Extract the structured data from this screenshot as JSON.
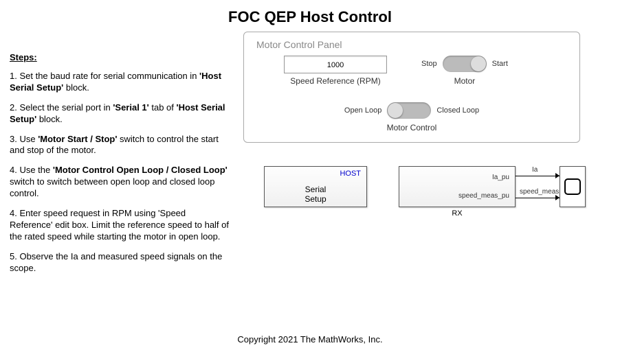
{
  "title": "FOC QEP Host Control",
  "steps_heading": "Steps:",
  "steps": {
    "s1a": "1. Set the baud rate for serial communication in ",
    "s1b": "'Host Serial Setup'",
    "s1c": " block.",
    "s2a": "2. Select the serial port in ",
    "s2b": "'Serial 1'",
    "s2c": " tab of  ",
    "s2d": "'Host Serial Setup'",
    "s2e": " block.",
    "s3a": "3. Use ",
    "s3b": "'Motor Start / Stop'",
    "s3c": " switch to control the start and stop of the motor.",
    "s4a": "4. Use the ",
    "s4b": "'Motor Control Open Loop / Closed Loop'",
    "s4c": " switch to switch between open loop and closed loop control.",
    "s5": "4. Enter speed request in RPM using 'Speed Reference' edit box. Limit the reference speed to half of the rated speed while starting the motor in open loop.",
    "s6": "5. Observe the Ia and measured speed signals on the scope."
  },
  "panel": {
    "title": "Motor Control Panel",
    "speed_ref_value": "1000",
    "speed_ref_label": "Speed Reference (RPM)",
    "motor_stop": "Stop",
    "motor_start": "Start",
    "motor_label": "Motor",
    "open_loop": "Open Loop",
    "closed_loop": "Closed Loop",
    "motor_control_label": "Motor Control"
  },
  "diagram": {
    "host_tag": "HOST",
    "host_text": "Serial\nSetup",
    "host_text_l1": "Serial",
    "host_text_l2": "Setup",
    "rx_port1": "Ia_pu",
    "rx_port2": "speed_meas_pu",
    "rx_label": "RX",
    "sig1": "Ia",
    "sig2": "speed_meas"
  },
  "copyright": "Copyright 2021 The MathWorks, Inc."
}
